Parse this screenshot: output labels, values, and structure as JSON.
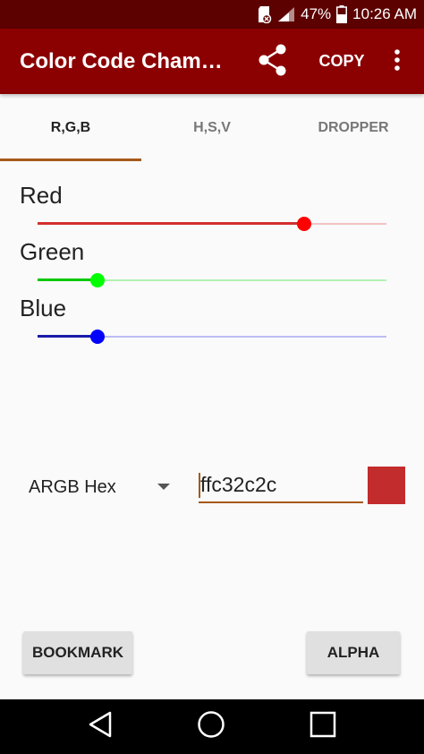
{
  "status_bar": {
    "battery": "47%",
    "time": "10:26 AM"
  },
  "app_bar": {
    "title": "Color Code Cham…",
    "copy_label": "COPY",
    "icons": {
      "share": "share-icon",
      "overflow": "more-vert-icon"
    }
  },
  "tabs": [
    {
      "label": "R,G,B",
      "active": true
    },
    {
      "label": "H,S,V",
      "active": false
    },
    {
      "label": "DROPPER",
      "active": false
    }
  ],
  "sliders": [
    {
      "label": "Red",
      "value": 195,
      "max": 255,
      "color": "#d32f2f",
      "track": "#f3c2c2",
      "thumb": "#ff0000"
    },
    {
      "label": "Green",
      "value": 44,
      "max": 255,
      "color": "#00c800",
      "track": "#b2f2b2",
      "thumb": "#00ff00"
    },
    {
      "label": "Blue",
      "value": 44,
      "max": 255,
      "color": "#1a1aaa",
      "track": "#bcbcf2",
      "thumb": "#0000ff"
    }
  ],
  "hex": {
    "format": "ARGB Hex",
    "value": "ffc32c2c",
    "swatch_color": "#c32c2c"
  },
  "buttons": {
    "bookmark": "BOOKMARK",
    "alpha": "ALPHA"
  },
  "colors": {
    "status_bar": "#5c0000",
    "app_bar": "#8b0000",
    "accent": "#a55a1a"
  }
}
